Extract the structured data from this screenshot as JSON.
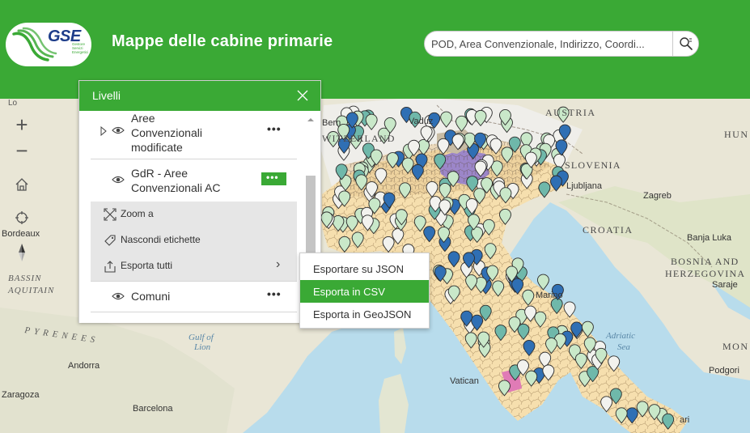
{
  "app": {
    "title": "Mappe delle cabine primarie",
    "logo_text": "GSE",
    "logo_subtext": "Gestore Servizi Energetici"
  },
  "search": {
    "placeholder": "POD, Area Convenzionale, Indirizzo, Coordi..."
  },
  "map_labels": [
    {
      "text": "AUSTRIA",
      "style": "country"
    },
    {
      "text": "HUN",
      "style": "country"
    },
    {
      "text": "SLOVENIA",
      "style": "country"
    },
    {
      "text": "CROATIA",
      "style": "country"
    },
    {
      "text": "BOSNIA AND",
      "style": "country"
    },
    {
      "text": "HERZEGOVINA",
      "style": "country"
    },
    {
      "text": "MON",
      "style": "country"
    },
    {
      "text": "BASSIN",
      "style": "region"
    },
    {
      "text": "AQUITAIN",
      "style": "region"
    },
    {
      "text": "WITZERLAND",
      "style": "country"
    },
    {
      "text": "PYRENEES",
      "style": "region"
    },
    {
      "text": "Bern",
      "style": "city"
    },
    {
      "text": "Vaduz",
      "style": "city"
    },
    {
      "text": "Ljubljana",
      "style": "city"
    },
    {
      "text": "Zagreb",
      "style": "city"
    },
    {
      "text": "Banja Luka",
      "style": "city"
    },
    {
      "text": "Saraje",
      "style": "city"
    },
    {
      "text": "Podgori",
      "style": "city"
    },
    {
      "text": "Bordeaux",
      "style": "city"
    },
    {
      "text": "Andorra",
      "style": "city"
    },
    {
      "text": "Zaragoza",
      "style": "city"
    },
    {
      "text": "Barcelona",
      "style": "city"
    },
    {
      "text": "Vatican",
      "style": "city"
    },
    {
      "text": "Marino",
      "style": "city"
    },
    {
      "text": "ari",
      "style": "city"
    },
    {
      "text": "Lo",
      "style": "city"
    },
    {
      "text": "Gulf of",
      "style": "sea"
    },
    {
      "text": "Lion",
      "style": "sea"
    },
    {
      "text": "Adriatic",
      "style": "sea"
    },
    {
      "text": "Sea",
      "style": "sea"
    }
  ],
  "tools": {
    "zoom_in": "+",
    "zoom_out": "−"
  },
  "layers_panel": {
    "title": "Livelli",
    "layers": [
      {
        "name": "Aree Convenzionali modificate",
        "lines": [
          "Aree",
          "Convenzionali",
          "modificate"
        ],
        "options": "•••"
      },
      {
        "name": "GdR - Aree Convenzionali AC",
        "lines": [
          "GdR - Aree",
          "Convenzionali AC"
        ],
        "options": "•••"
      },
      {
        "name": "Comuni",
        "lines": [
          "Comuni"
        ],
        "options": "•••"
      }
    ],
    "actions": {
      "zoom": "Zoom a",
      "hide_labels": "Nascondi etichette",
      "export_all": "Esporta tutti",
      "chevron": "›"
    }
  },
  "export_menu": {
    "items": [
      "Esportare su JSON",
      "Esporta in CSV",
      "Esporta in GeoJSON"
    ],
    "active_index": 1
  },
  "colors": {
    "brand_green": "#3aa935",
    "marker_light": "#c9e8c9",
    "marker_white": "#f2f2ee",
    "marker_teal": "#6fb8aa",
    "marker_blue": "#2f6fb4",
    "region_beige": "#f6dfae",
    "region_purple": "#9c86c9",
    "sea": "#b6dcec"
  }
}
